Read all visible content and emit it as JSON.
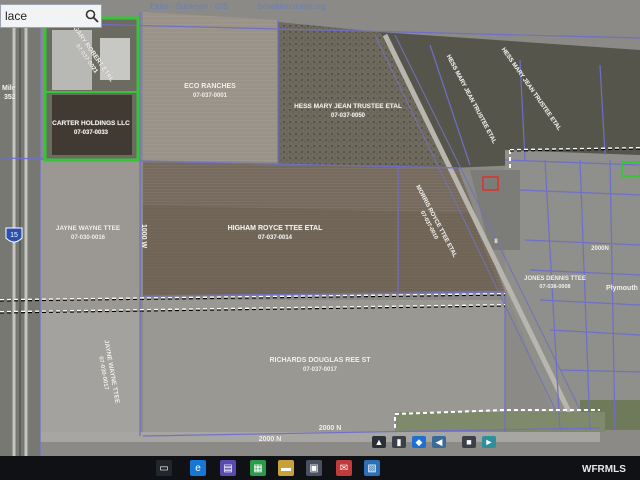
{
  "search": {
    "value": "lace",
    "placeholder": "Search"
  },
  "header": {
    "title_fragment": "Elder - Surveyor - GIS",
    "site": "boxeldercounty.org"
  },
  "map": {
    "parcels": [
      {
        "owner": "GARY ROBERT ETAL",
        "parcel_id": "07-037-0021"
      },
      {
        "owner": "CARTER HOLDINGS LLC",
        "parcel_id": "07-037-0033"
      },
      {
        "owner": "ECO RANCHES",
        "parcel_id": "07-037-0001"
      },
      {
        "owner": "HESS MARY JEAN TRUSTEE ETAL",
        "parcel_id": "07-037-0050"
      },
      {
        "owner": "JAYNE WAYNE TTEE",
        "parcel_id": "07-030-0016"
      },
      {
        "owner": "HIGHAM ROYCE TTEE ETAL",
        "parcel_id": "07-037-0014"
      },
      {
        "owner": "MORRIS ROYCE TTEE ETAL",
        "parcel_id": "07-037-0010"
      },
      {
        "owner": "RICHARDS DOUGLAS REE ST",
        "parcel_id": "07-037-0017"
      },
      {
        "owner": "JAYNE WAYNE TTEE",
        "parcel_id": "07-030-0017"
      },
      {
        "owner": "HESS MARY JEAN TRUSTEE ETAL",
        "parcel_id": ""
      },
      {
        "owner": "HESS MARY JEAN TRUSTEE ETAL",
        "parcel_id": ""
      },
      {
        "owner": "JONES DENNIS TTEE",
        "parcel_id": "07-038-0008"
      }
    ],
    "labels": {
      "mile_marker": "Mile",
      "mile_number": "352",
      "interstate": "15",
      "road_2000": "2000 N",
      "road_bottom": "2000 N",
      "road_right": "2000N",
      "road_vertical": "1000 W",
      "town": "Plymouth",
      "hwy": "8"
    }
  },
  "taskbar": {
    "icons": [
      "task-view-icon",
      "edge-icon",
      "store-icon",
      "calculator-icon",
      "folder-icon",
      "lock-icon",
      "mail-icon",
      "photos-icon"
    ],
    "tray_icons": [
      "up-arrow-icon",
      "network-icon",
      "dropbox-icon",
      "volume-icon",
      "message-icon",
      "keyboard-icon"
    ]
  },
  "watermark": "WFRMLS"
}
